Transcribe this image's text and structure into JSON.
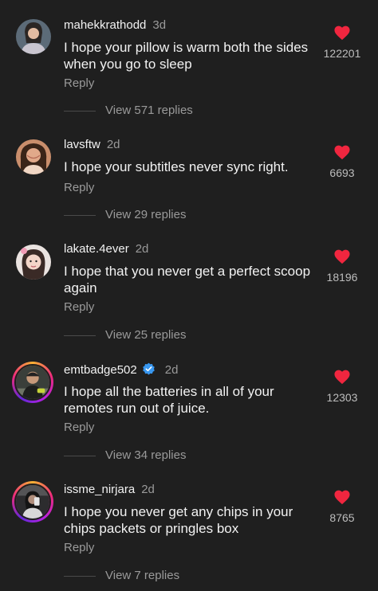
{
  "comments": [
    {
      "username": "mahekkrathodd",
      "time": "3d",
      "text": "I hope your pillow is warm both the sides when you go to sleep",
      "reply_label": "Reply",
      "likes": "122201",
      "view_replies": "View 571 replies",
      "verified": false,
      "story_ring": false,
      "avatar_icon": "profile-photo",
      "liked": true
    },
    {
      "username": "lavsftw",
      "time": "2d",
      "text": "I hope your subtitles never sync right.",
      "reply_label": "Reply",
      "likes": "6693",
      "view_replies": "View 29 replies",
      "verified": false,
      "story_ring": false,
      "avatar_icon": "profile-photo",
      "liked": true
    },
    {
      "username": "lakate.4ever",
      "time": "2d",
      "text": "I hope that you never get a perfect scoop again",
      "reply_label": "Reply",
      "likes": "18196",
      "view_replies": "View 25 replies",
      "verified": false,
      "story_ring": false,
      "avatar_icon": "profile-photo",
      "liked": true
    },
    {
      "username": "emtbadge502",
      "time": "2d",
      "text": "I hope all the batteries in all of your remotes run out of juice.",
      "reply_label": "Reply",
      "likes": "12303",
      "view_replies": "View 34 replies",
      "verified": true,
      "story_ring": true,
      "avatar_icon": "profile-photo",
      "liked": true
    },
    {
      "username": "issme_nirjara",
      "time": "2d",
      "text": "I hope you never get any chips in your chips packets or pringles box",
      "reply_label": "Reply",
      "likes": "8765",
      "view_replies": "View 7 replies",
      "verified": false,
      "story_ring": true,
      "avatar_icon": "profile-photo",
      "liked": true
    }
  ],
  "colors": {
    "background": "#1f1f1f",
    "heart": "#f0263f",
    "verified": "#3897f0",
    "muted_text": "#9a9a9a"
  }
}
